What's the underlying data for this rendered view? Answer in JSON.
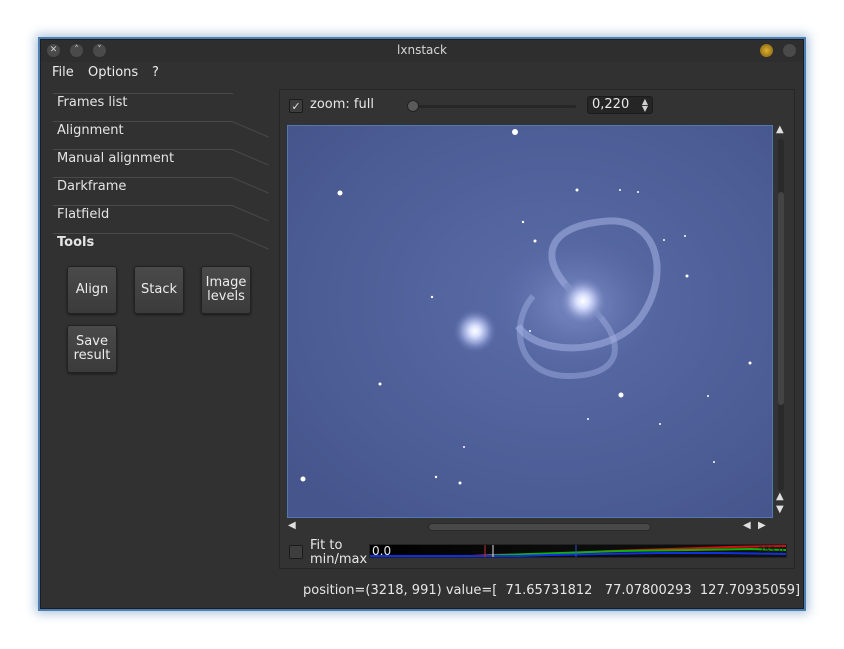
{
  "window": {
    "title": "lxnstack",
    "controls": [
      "close-icon",
      "minimize-icon",
      "maximize-icon"
    ],
    "accent_color": "#4b7fb4"
  },
  "menubar": {
    "file": "File",
    "options": "Options",
    "help": "?"
  },
  "tool_tabs": {
    "frames_list": "Frames list",
    "alignment": "Alignment",
    "manual_alignment": "Manual alignment",
    "darkframe": "Darkframe",
    "flatfield": "Flatfield",
    "tools": "Tools"
  },
  "tools": {
    "align": "Align",
    "stack": "Stack",
    "image_levels_line1": "Image",
    "image_levels_line2": "levels",
    "save_result_line1": "Save",
    "save_result_line2": "result"
  },
  "viewer": {
    "zoom_checked": true,
    "zoom_label": "zoom: full",
    "zoom_value": "0,220",
    "zoom_slider_fraction": 0.0,
    "image_subject": "spiral galaxy starfield",
    "image_color": "#4b5c95"
  },
  "levels": {
    "fit_label_line1": "Fit to",
    "fit_label_line2": "min/max",
    "fit_checked": false,
    "min_value": "0.0",
    "max_value": "255.0",
    "channel_colors": [
      "#d01010",
      "#10b010",
      "#1030e0"
    ]
  },
  "status": {
    "text": "position=(3218, 991) value=[  71.65731812   77.07800293  127.70935059]"
  }
}
